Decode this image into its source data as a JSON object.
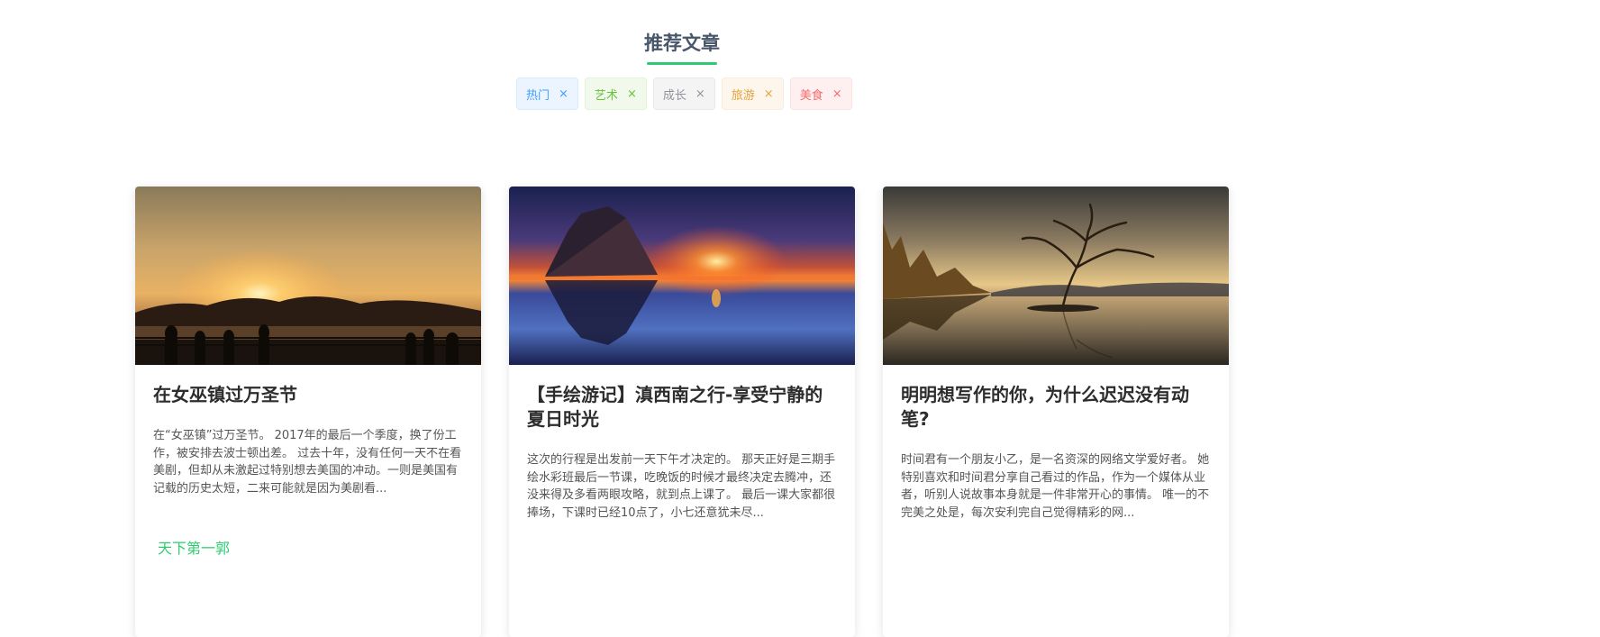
{
  "section": {
    "title": "推荐文章"
  },
  "tags": [
    {
      "label": "热门",
      "color": "#409eff",
      "bg": "#ecf5ff",
      "border": "#d9ecff"
    },
    {
      "label": "艺术",
      "color": "#67c23a",
      "bg": "#f0f9eb",
      "border": "#e1f3d8"
    },
    {
      "label": "成长",
      "color": "#909399",
      "bg": "#f4f4f5",
      "border": "#e9e9eb"
    },
    {
      "label": "旅游",
      "color": "#e6a23c",
      "bg": "#fdf6ec",
      "border": "#faecd8"
    },
    {
      "label": "美食",
      "color": "#f56c6c",
      "bg": "#fef0f0",
      "border": "#fde2e2"
    }
  ],
  "tag_close_glyph": "×",
  "cards": [
    {
      "title": "在女巫镇过万圣节",
      "excerpt": "在“女巫镇”过万圣节。 2017年的最后一个季度，换了份工作，被安排去波士顿出差。 过去十年，没有任何一天不在看美剧，但却从未激起过特别想去美国的冲动。一则是美国有记载的历史太短，二来可能就是因为美剧看...",
      "author": "天下第一郭"
    },
    {
      "title": "【手绘游记】滇西南之行-享受宁静的夏日时光",
      "excerpt": "这次的行程是出发前一天下午才决定的。 那天正好是三期手绘水彩班最后一节课，吃晚饭的时候才最终决定去腾冲，还没来得及多看两眼攻略，就到点上课了。 最后一课大家都很捧场，下课时已经10点了，小七还意犹未尽...",
      "author": ""
    },
    {
      "title": "明明想写作的你，为什么迟迟没有动笔?",
      "excerpt": "时间君有一个朋友小乙，是一名资深的网络文学爱好者。 她特别喜欢和时间君分享自己看过的作品，作为一个媒体从业者，听别人说故事本身就是一件非常开心的事情。 唯一的不完美之处是，每次安利完自己觉得精彩的网...",
      "author": ""
    }
  ]
}
